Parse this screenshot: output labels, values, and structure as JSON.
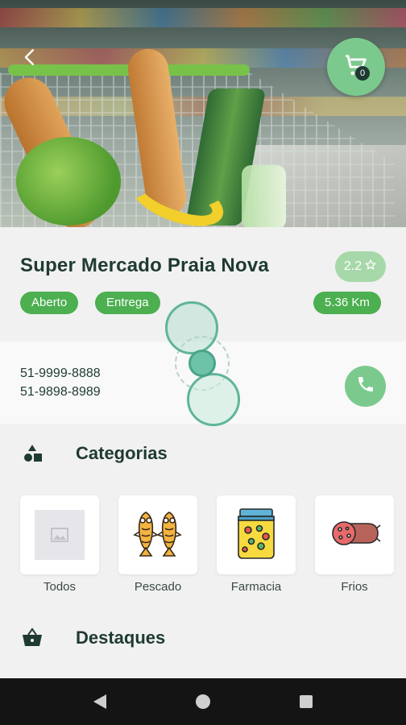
{
  "header": {
    "back_icon": "arrow-left-icon",
    "cart": {
      "icon": "shopping-cart-icon",
      "count": "0"
    }
  },
  "store": {
    "name": "Super Mercado Praia Nova",
    "rating": "2.2",
    "rating_icon": "star-outline-icon",
    "status": "Aberto",
    "delivery": "Entrega",
    "distance": "5.36 Km"
  },
  "contact": {
    "phone_1": "51-9999-8888",
    "phone_2": "51-9898-8989",
    "call_icon": "phone-icon"
  },
  "categories": {
    "title": "Categorias",
    "icon": "shapes-icon",
    "items": [
      {
        "label": "Todos",
        "icon": "image-placeholder-icon"
      },
      {
        "label": "Pescado",
        "icon": "fish-icon"
      },
      {
        "label": "Farmacia",
        "icon": "jar-icon"
      },
      {
        "label": "Frios",
        "icon": "salami-icon"
      }
    ]
  },
  "highlights": {
    "title": "Destaques",
    "icon": "basket-icon"
  },
  "colors": {
    "primary_green": "#4caf50",
    "light_green": "#7cc98e",
    "dark_text": "#1f3a33"
  }
}
